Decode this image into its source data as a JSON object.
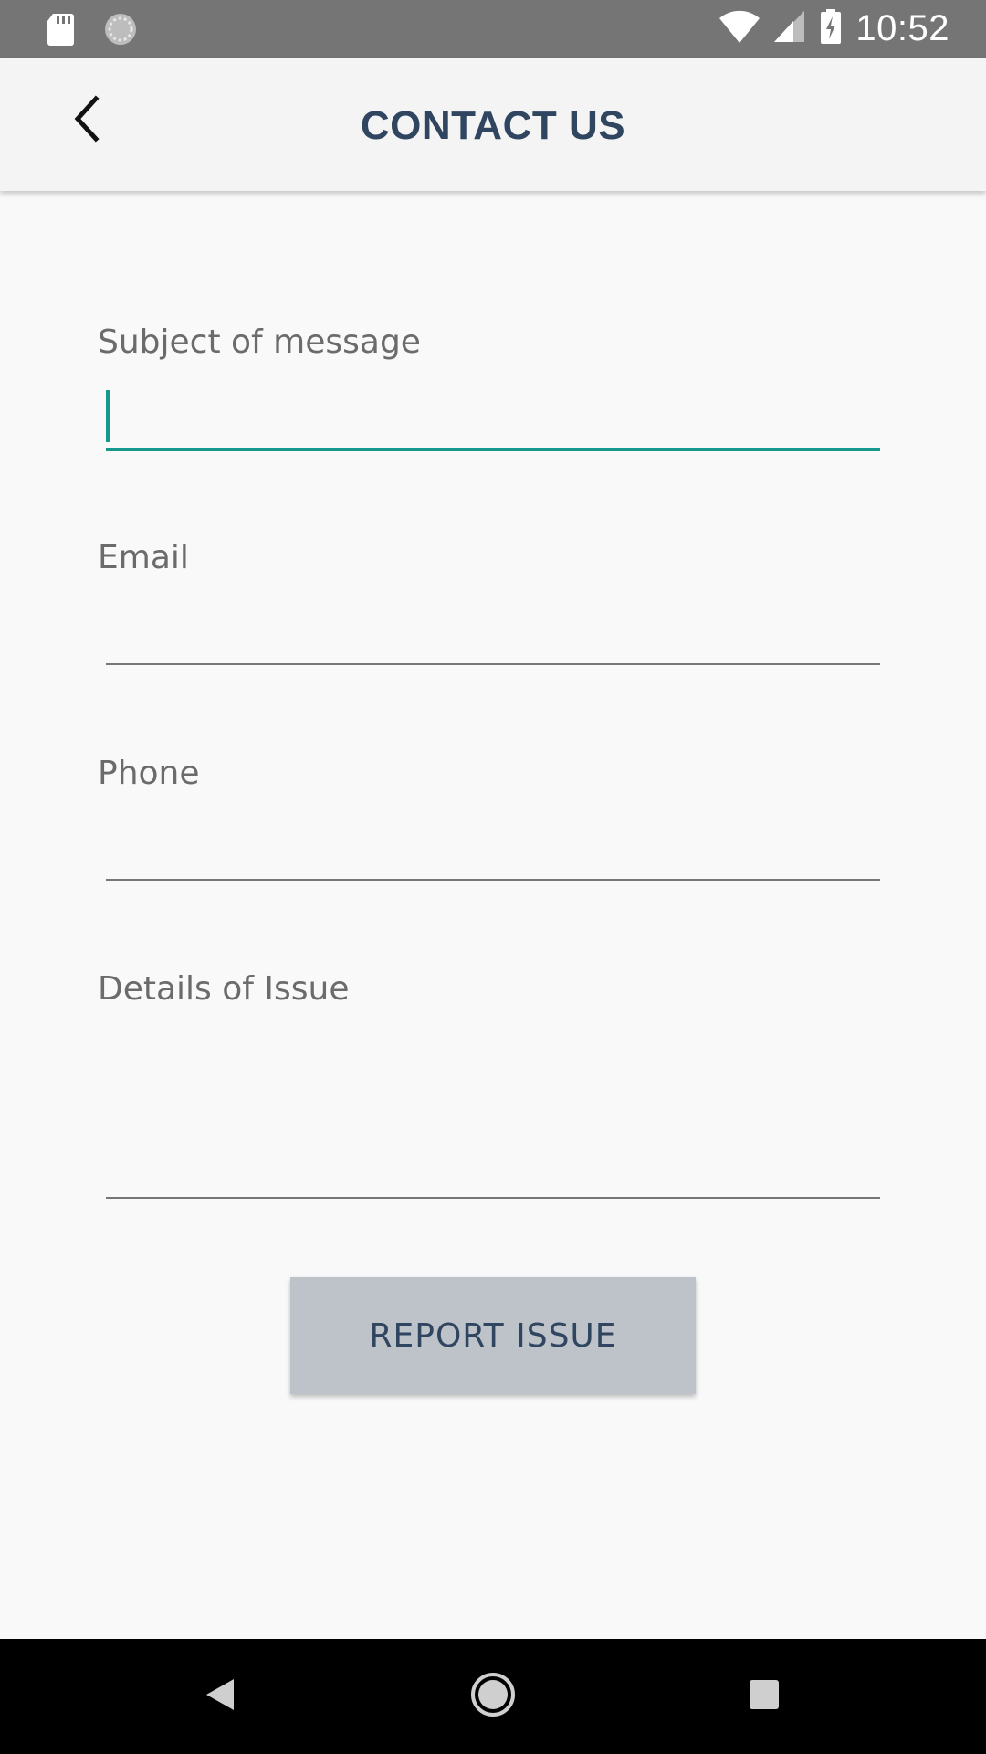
{
  "status_bar": {
    "time": "10:52",
    "icons": [
      "sd-card-icon",
      "sync-icon",
      "wifi-icon",
      "cell-signal-icon",
      "battery-charging-icon"
    ]
  },
  "app_bar": {
    "title": "CONTACT US",
    "back_icon": "chevron-left-icon"
  },
  "form": {
    "subject": {
      "label": "Subject of message",
      "value": "",
      "focused": true
    },
    "email": {
      "label": "Email",
      "value": ""
    },
    "phone": {
      "label": "Phone",
      "value": ""
    },
    "details": {
      "label": "Details of Issue",
      "value": ""
    },
    "submit_label": "REPORT ISSUE"
  },
  "nav_bar": {
    "buttons": [
      "back-triangle-icon",
      "home-circle-icon",
      "recents-square-icon"
    ]
  },
  "colors": {
    "status_bar": "#757575",
    "app_bar": "#f4f4f4",
    "title": "#2f4560",
    "accent": "#16988a",
    "button_bg": "#bec3c9"
  }
}
